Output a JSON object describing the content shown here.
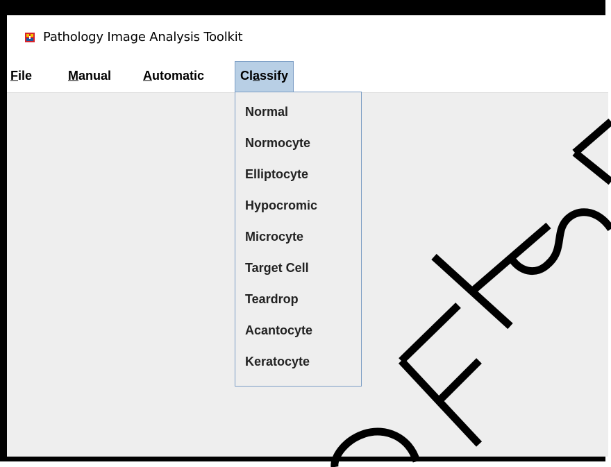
{
  "window": {
    "title": "Pathology Image Analysis Toolkit",
    "icon": "java-app-icon"
  },
  "menubar": {
    "items": [
      {
        "pre": "",
        "mnemonic": "F",
        "post": "ile"
      },
      {
        "pre": "",
        "mnemonic": "M",
        "post": "anual"
      },
      {
        "pre": "",
        "mnemonic": "A",
        "post": "utomatic"
      },
      {
        "pre": "Cl",
        "mnemonic": "a",
        "post": "ssify"
      }
    ],
    "active_index": 3
  },
  "classify_menu": {
    "items": [
      "Normal",
      "Normocyte",
      "Elliptocyte",
      "Hypocromic",
      "Microcyte",
      "Target Cell",
      "Teardrop",
      "Acantocyte",
      "Keratocyte"
    ]
  },
  "colors": {
    "menu_highlight": "#b8cfe5",
    "menu_border": "#7a9cc4",
    "window_bg": "#eeeeee"
  },
  "watermark": {
    "text": "@FTSM"
  }
}
